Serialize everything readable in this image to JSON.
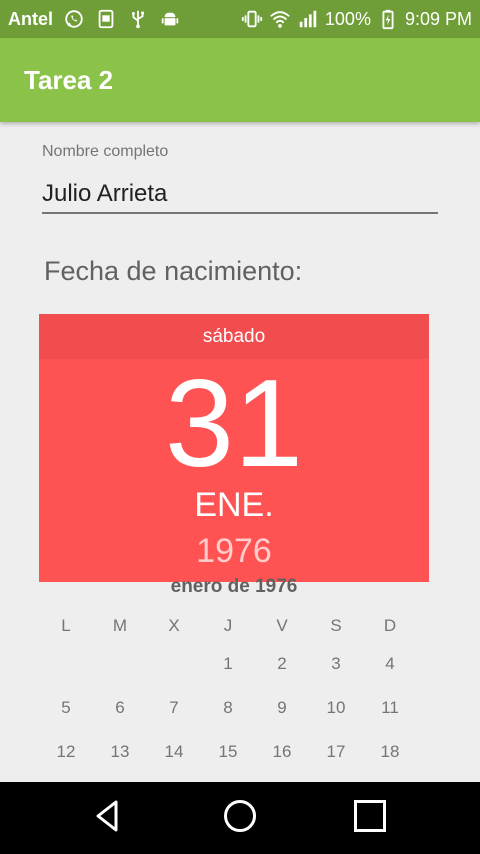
{
  "status_bar": {
    "carrier": "Antel",
    "battery": "100%",
    "time": "9:09 PM",
    "icons": [
      "whatsapp-icon",
      "badge-100-icon",
      "usb-icon",
      "android-icon",
      "vibrate-icon",
      "wifi-icon",
      "signal-icon",
      "battery-charging-icon"
    ]
  },
  "app_bar": {
    "title": "Tarea 2"
  },
  "form": {
    "name_label": "Nombre completo",
    "name_value": "Julio Arrieta",
    "birth_label": "Fecha de nacimiento:"
  },
  "date_picker": {
    "weekday": "sábado",
    "day": "31",
    "month": "ENE.",
    "year": "1976",
    "calendar_month": "enero de 1976",
    "weekday_headers": [
      "L",
      "M",
      "X",
      "J",
      "V",
      "S",
      "D"
    ],
    "days": [
      "",
      "",
      "",
      "1",
      "2",
      "3",
      "4",
      "5",
      "6",
      "7",
      "8",
      "9",
      "10",
      "11",
      "12",
      "13",
      "14",
      "15",
      "16",
      "17",
      "18"
    ]
  },
  "colors": {
    "status_bar": "#6f9e38",
    "app_bar": "#8bc34a",
    "picker_header": "#ff5252",
    "picker_weekday_band": "#f14d4f"
  },
  "nav_bar": {
    "icons": [
      "back-icon",
      "home-icon",
      "recents-icon"
    ]
  }
}
